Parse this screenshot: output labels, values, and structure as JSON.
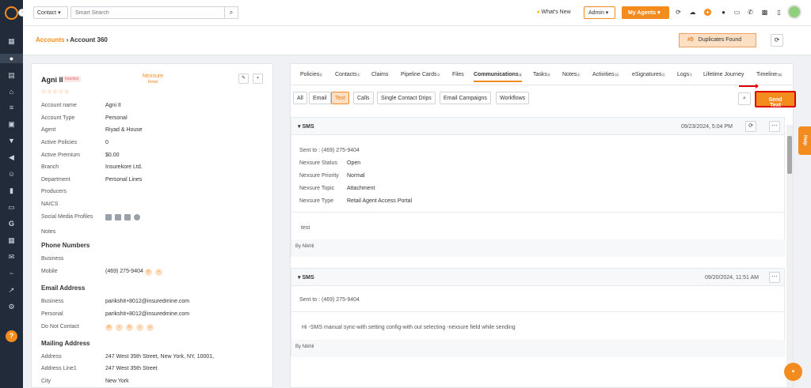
{
  "topbar": {
    "contact_select": "Contact",
    "search_placeholder": "Smart Search",
    "whats_new": "What's New",
    "admin": "Admin",
    "my_agents": "My Agents"
  },
  "header": {
    "breadcrumb_parent": "Accounts",
    "breadcrumb_current": "Account 360",
    "duplicates_count": "#5",
    "duplicates_label": "Duplicates Found"
  },
  "account": {
    "name": "Agni II",
    "status": "Inactive",
    "logo_name": "Nexsure",
    "logo_sub": "Retail",
    "fields": [
      {
        "label": "Account name",
        "value": "Agni II"
      },
      {
        "label": "Account Type",
        "value": "Personal"
      },
      {
        "label": "Agent",
        "value": "Riyad & House"
      },
      {
        "label": "Active Policies",
        "value": "0"
      },
      {
        "label": "Active Premium",
        "value": "$0.00"
      },
      {
        "label": "Branch",
        "value": "Insurekore Ltd."
      },
      {
        "label": "Department",
        "value": "Personal Lines"
      },
      {
        "label": "Producers",
        "value": ""
      },
      {
        "label": "NAICS",
        "value": ""
      },
      {
        "label": "Social Media Profiles",
        "value": ""
      },
      {
        "label": "Notes",
        "value": ""
      }
    ],
    "phone_section": "Phone Numbers",
    "phone_business_label": "Business",
    "phone_mobile_label": "Mobile",
    "phone_mobile": "(469) 275-9404",
    "email_section": "Email Address",
    "email_business_label": "Business",
    "email_business": "parikshit+8012@insuredmine.com",
    "email_personal_label": "Personal",
    "email_personal": "parikshit+8012@insuredmine.com",
    "do_not_contact_label": "Do Not Contact",
    "mailing_section": "Mailing Address",
    "address_label": "Address",
    "address": "247 West 35th Street, New York, NY, 10001,",
    "address1_label": "Address Line1",
    "address1": "247 West 35th Street",
    "city_label": "City",
    "city": "New York"
  },
  "tabs": [
    {
      "label": "Policies",
      "count": "0"
    },
    {
      "label": "Contacts",
      "count": "1"
    },
    {
      "label": "Claims",
      "count": ""
    },
    {
      "label": "Pipeline Cards",
      "count": "0"
    },
    {
      "label": "Files",
      "count": ""
    },
    {
      "label": "Communications",
      "count": "4"
    },
    {
      "label": "Tasks",
      "count": "5"
    },
    {
      "label": "Notes",
      "count": "4"
    },
    {
      "label": "Activities",
      "count": "11"
    },
    {
      "label": "eSignatures",
      "count": "0"
    },
    {
      "label": "Logs",
      "count": "7"
    },
    {
      "label": "Lifetime Journey",
      "count": ""
    },
    {
      "label": "Timeline",
      "count": "38"
    }
  ],
  "subtabs": [
    "All",
    "Email",
    "Text",
    "Calls",
    "Single Contact Drips",
    "Email Campaigns",
    "Workflows"
  ],
  "send_text": "Send Text",
  "messages": [
    {
      "type": "SMS",
      "date": "09/23/2024, 5:04 PM",
      "sent_to": "Sent to : (469) 275-9404",
      "details": [
        {
          "label": "Nexsure Status",
          "value": "Open"
        },
        {
          "label": "Nexsure Priority",
          "value": "Normal"
        },
        {
          "label": "Nexsure Topic",
          "value": "Attachment"
        },
        {
          "label": "Nexsure Type",
          "value": "Retail Agent Access Portal"
        }
      ],
      "body": "test",
      "by": "By Nikhil"
    },
    {
      "type": "SMS",
      "date": "09/20/2024, 11:51 AM",
      "sent_to": "Sent to : (469) 275-9404",
      "body": "Hi -SMS manual sync-with setting config-with out selecting -nexsure field while sending",
      "by": "By Nikhil"
    }
  ],
  "help_tab": "Help",
  "icons": [
    "home-icon",
    "user-icon",
    "file-icon",
    "bank-icon",
    "list-icon",
    "image-icon",
    "filter-icon",
    "megaphone-icon",
    "users-icon",
    "chart-icon",
    "folder-icon",
    "g-icon",
    "calendar-icon",
    "mail-icon",
    "handshake-icon",
    "trend-icon",
    "settings-icon"
  ],
  "colors": {
    "accent": "#f48b1f",
    "sidebar": "#222b3a",
    "highlight": "#e10000"
  }
}
